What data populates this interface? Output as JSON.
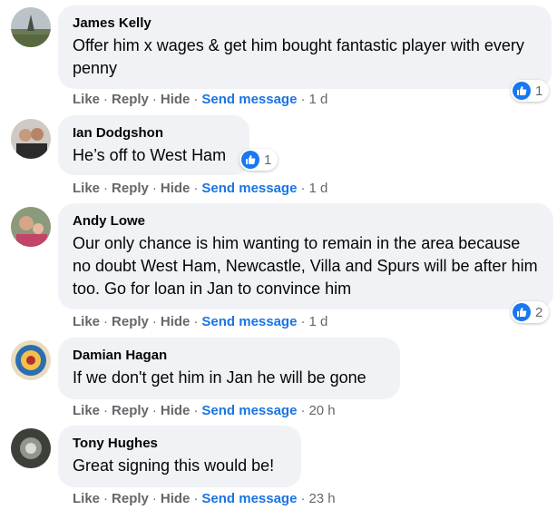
{
  "actions": {
    "like": "Like",
    "reply": "Reply",
    "hide": "Hide",
    "send_message": "Send message",
    "dot": "·"
  },
  "comments": [
    {
      "author": "James Kelly",
      "text": "Offer him x wages & get him bought fantastic player with every penny",
      "time": "1 d",
      "reactions": "1",
      "avatar_icon": "landscape-avatar"
    },
    {
      "author": "Ian Dodgshon",
      "text": "He’s off to West Ham",
      "time": "1 d",
      "reactions": "1",
      "avatar_icon": "couple-avatar"
    },
    {
      "author": "Andy Lowe",
      "text": "Our only chance is him wanting to remain in the area because no doubt West Ham, Newcastle, Villa and Spurs will be after him too. Go for loan in Jan to convince him",
      "time": "1 d",
      "reactions": "2",
      "avatar_icon": "family-avatar"
    },
    {
      "author": "Damian Hagan",
      "text": "If we don't get him in Jan he will be gone",
      "time": "20 h",
      "reactions": "",
      "avatar_icon": "badge-avatar"
    },
    {
      "author": "Tony Hughes",
      "text": "Great signing this would be!",
      "time": "23 h",
      "reactions": "",
      "avatar_icon": "dark-avatar"
    }
  ],
  "colors": {
    "bubble": "#f0f2f5",
    "link": "#1b74e4",
    "meta": "#65676b",
    "like": "#1877f2"
  }
}
